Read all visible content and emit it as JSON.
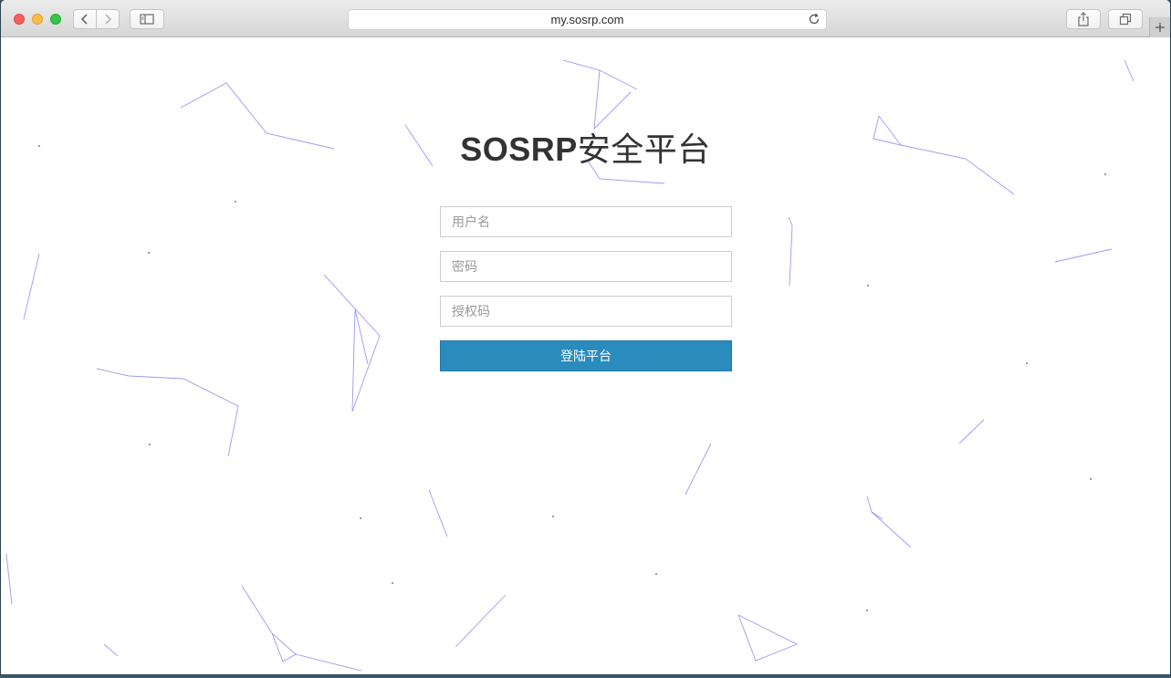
{
  "browser": {
    "url": "my.sosrp.com"
  },
  "page": {
    "title_brand": "SOSRP",
    "title_suffix": "安全平台"
  },
  "form": {
    "username_placeholder": "用户名",
    "password_placeholder": "密码",
    "authcode_placeholder": "授权码",
    "submit_label": "登陆平台"
  },
  "colors": {
    "accent": "#2a8bbd",
    "network_lines": "#6f6ff0"
  }
}
